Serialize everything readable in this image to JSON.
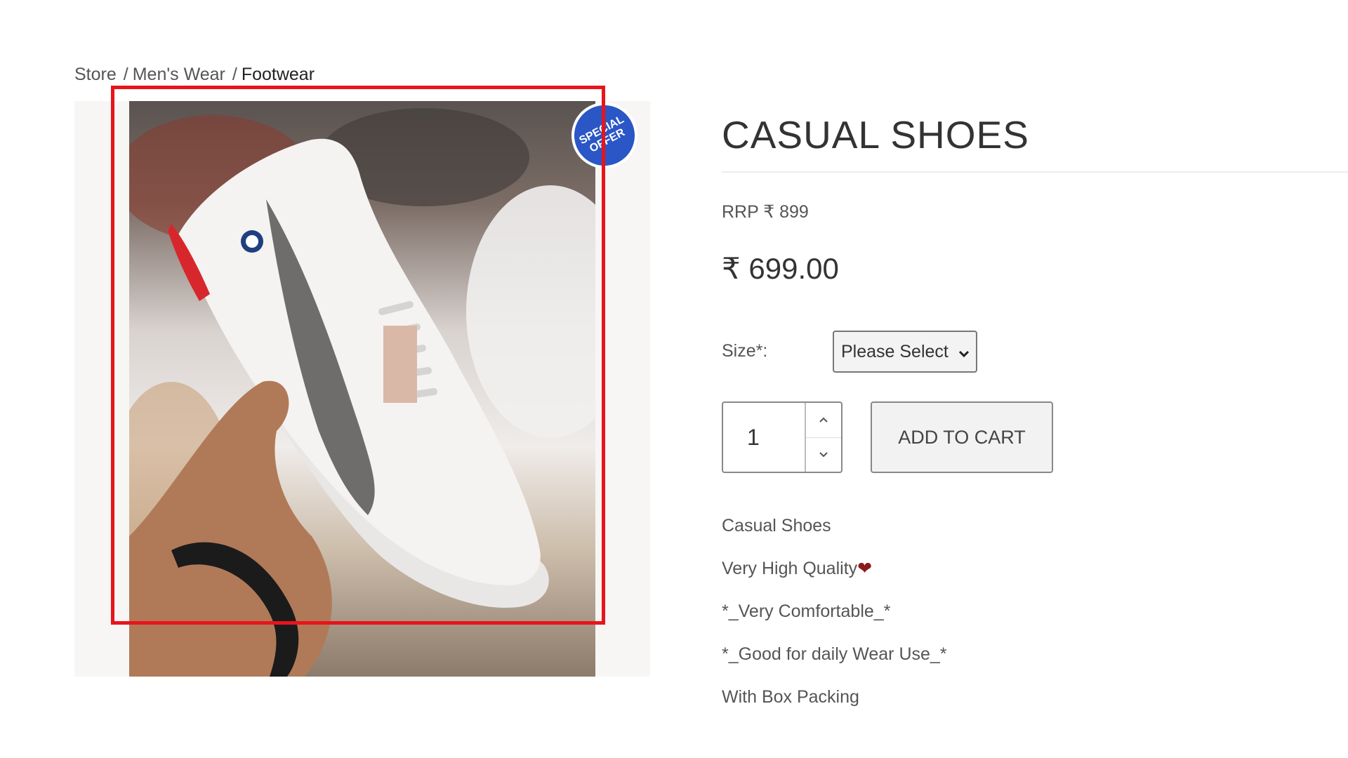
{
  "breadcrumb": {
    "items": [
      "Store",
      "Men's Wear",
      "Footwear"
    ],
    "separator": "/"
  },
  "product": {
    "badge_line1": "SPECIAL",
    "badge_line2": "OFFER",
    "title": "CASUAL SHOES",
    "rrp": "RRP ₹ 899",
    "price": "₹ 699.00",
    "size_label": "Size*:",
    "size_selected": "Please Select",
    "quantity": "1",
    "add_to_cart": "ADD TO CART",
    "description": [
      "Casual Shoes",
      "Very High Quality",
      "*_Very Comfortable_*",
      "*_Good for daily Wear Use_*",
      "With Box Packing"
    ],
    "quality_emoji": "❤"
  },
  "colors": {
    "highlight": "#e8141b",
    "badge": "#2a56c6"
  }
}
